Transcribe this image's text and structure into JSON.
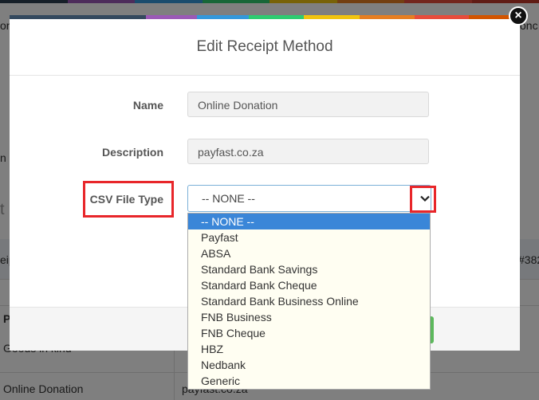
{
  "background": {
    "stripe_colors": [
      "#2d3e50",
      "#9b59b6",
      "#3498db",
      "#2ecc71",
      "#f1c40f",
      "#e67e22",
      "#e74c3c",
      "#c0392b"
    ],
    "row_texts": [
      "Online Donation",
      "payfast.co.za"
    ],
    "partial_texts": [
      "onc",
      "onc",
      "n",
      "t",
      "eip",
      "#382",
      "P",
      "Goods in kind"
    ]
  },
  "modal": {
    "title": "Edit Receipt Method",
    "stripe_colors": [
      "#34495e",
      "#9b59b6",
      "#3498db",
      "#2ecc71",
      "#f1c40f",
      "#e67e22",
      "#e74c3c",
      "#d35400"
    ],
    "close_label": "×",
    "fields": {
      "name_label": "Name",
      "name_value": "Online Donation",
      "description_label": "Description",
      "description_value": "payfast.co.za",
      "csv_label": "CSV File Type",
      "csv_selected": "-- NONE --"
    },
    "csv_options": [
      "-- NONE --",
      "Payfast",
      "ABSA",
      "Standard Bank Savings",
      "Standard Bank Cheque",
      "Standard Bank Business Online",
      "FNB Business",
      "FNB Cheque",
      "HBZ",
      "Nedbank",
      "Generic"
    ],
    "highlight_color": "#e8262a",
    "selected_option_color": "#3a86d8"
  }
}
